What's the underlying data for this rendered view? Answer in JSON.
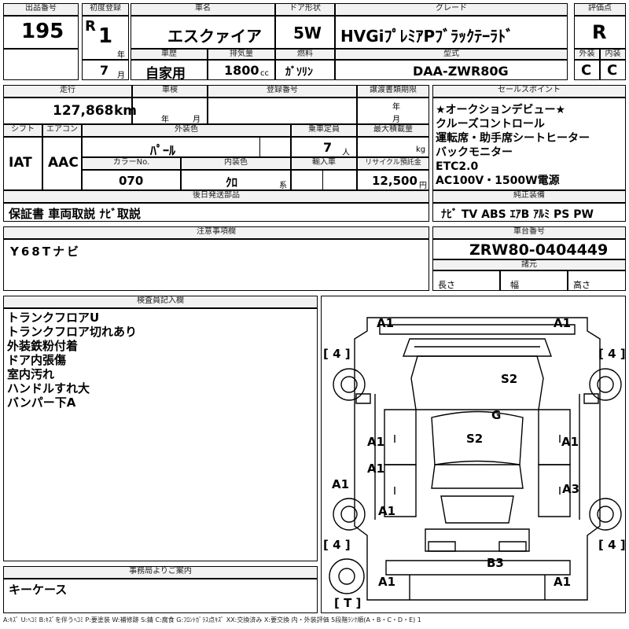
{
  "labels": {
    "lot_no": "出品番号",
    "first_reg": "初度登録",
    "car_name": "車名",
    "door": "ドア形状",
    "grade": "グレード",
    "rating": "評価点",
    "history": "車歴",
    "displacement": "排気量",
    "fuel": "燃料",
    "model": "型式",
    "exterior": "外装",
    "interior": "内装",
    "mileage": "走行",
    "inspection": "車検",
    "reg_no": "登録番号",
    "transfer": "譲渡書類期限",
    "sales_point": "セールスポイント",
    "shift": "シフト",
    "aircon": "エアコン",
    "ext_color": "外装色",
    "capacity": "乗車定員",
    "max_load": "最大積載量",
    "color_no": "カラーNo.",
    "int_color": "内装色",
    "import": "輸入車",
    "recycle": "リサイクル預託金",
    "later_parts": "後日発送部品",
    "genuine_equipment": "純正装備",
    "notes": "注意事項欄",
    "chassis_no": "車台番号",
    "specs": "諸元",
    "inspector_notes": "検査員記入欄",
    "office_notes": "事務局よりご案内"
  },
  "units": {
    "year": "年",
    "month": "月",
    "cc": "cc",
    "km": "km",
    "person": "人",
    "kg": "kg",
    "yen": "円",
    "series": "系",
    "length": "長さ",
    "width": "幅",
    "height": "高さ"
  },
  "values": {
    "lot_no": "195",
    "era": "R",
    "reg_year": "1",
    "reg_month": "7",
    "car_name": "エスクァイア",
    "door": "5W",
    "grade": "HVGiﾌﾟﾚﾐｱPﾌﾞﾗｯｸﾃｰﾗﾄﾞ",
    "rating": "R",
    "history": "自家用",
    "displacement": "1800",
    "fuel": "ｶﾞｿﾘﾝ",
    "model": "DAA-ZWR80G",
    "exterior": "C",
    "interior": "C",
    "mileage": "127,868",
    "shift": "IAT",
    "aircon": "AAC",
    "ext_color": "ﾊﾟｰﾙ",
    "capacity": "7",
    "color_no": "070",
    "int_color": "ｸﾛ",
    "recycle": "12,500",
    "later_parts": "保証書 車両取説 ﾅﾋﾞ取説",
    "genuine_equipment": "ﾅﾋﾞ TV ABS ｴｱB ｱﾙﾐ PS PW",
    "notes": "Y68Tナビ",
    "chassis_no": "ZRW80-0404449"
  },
  "sales_points": [
    "★オークションデビュー★",
    "クルーズコントロール",
    "運転席・助手席シートヒーター",
    "バックモニター",
    "ETC2.0",
    "AC100V・1500W電源"
  ],
  "inspector_notes": [
    "トランクフロアU",
    "トランクフロア切れあり",
    "外装鉄粉付着",
    "ドア内張傷",
    "室内汚れ",
    "ハンドルすれ大",
    "バンパー下A"
  ],
  "office_notes": "キーケース",
  "diagram_marks": {
    "a1_fl": "A1",
    "a1_fr": "A1",
    "tyre_fl": "[ 4 ]",
    "tyre_fr": "[ 4 ]",
    "s2_hood": "S2",
    "g_glass": "G",
    "s2_roof": "S2",
    "a1_door_lf": "A1",
    "a1_door_rf": "A1",
    "a1_door_lr": "A1",
    "a3_door_rr": "A3",
    "a1_left_side": "A1",
    "a1_fender_rl": "A1",
    "tyre_rl": "[ 4 ]",
    "tyre_rr": "[ 4 ]",
    "b3_rear": "B3",
    "a1_rl": "A1",
    "a1_rr": "A1",
    "spare": "[ T ]"
  },
  "legend": "A:ｷｽﾞ U:ﾍｺﾐ B:ｷｽﾞを伴うﾍｺﾐ P:要塗装 W:補修跡 S:錆 C:腐食 G:ﾌﾛﾝﾄｶﾞﾗｽ点ｷｽﾞ XX:交換済み X:要交換 内・外装評価 5段階ﾗﾝｸ順(A・B・C・D・E) 1"
}
